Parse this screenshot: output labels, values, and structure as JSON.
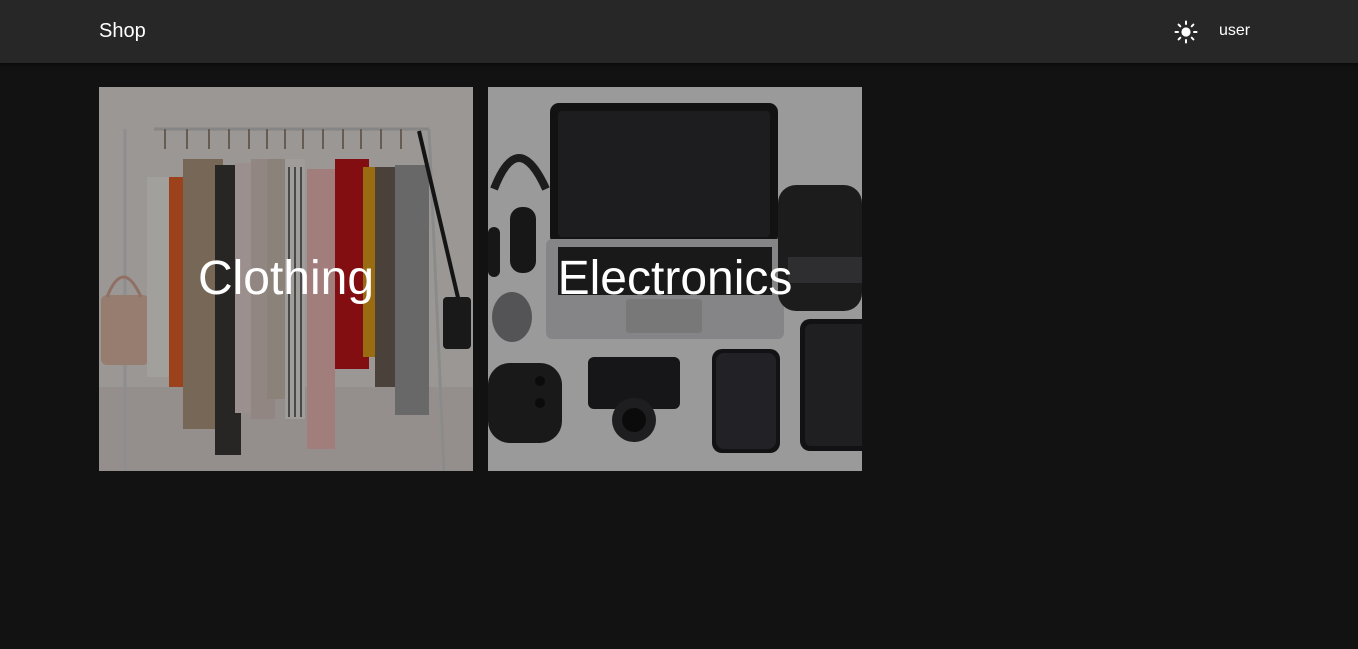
{
  "header": {
    "brand": "Shop",
    "theme_toggle_icon": "sun-icon",
    "user_label": "user"
  },
  "categories": [
    {
      "label": "Clothing",
      "image_icon": "clothing-rack-image"
    },
    {
      "label": "Electronics",
      "image_icon": "electronics-flatlay-image"
    }
  ],
  "colors": {
    "background": "#121212",
    "app_bar": "#272727",
    "text": "#ffffff"
  }
}
